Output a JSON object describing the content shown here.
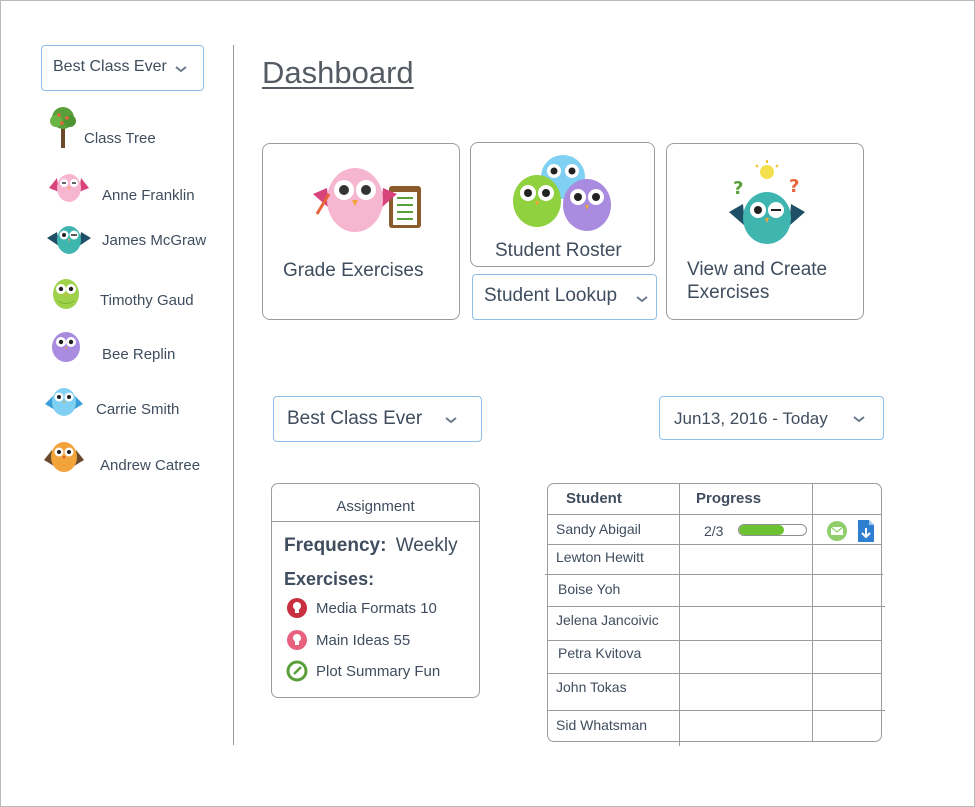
{
  "sidebar": {
    "class_select": "Best Class Ever",
    "items": [
      {
        "label": "Class Tree",
        "icon": "tree-icon"
      },
      {
        "label": "Anne Franklin",
        "icon": "owl-pink-icon",
        "color": "#f7b6cf"
      },
      {
        "label": "James McGraw",
        "icon": "owl-teal-icon",
        "color": "#3fb5b0"
      },
      {
        "label": "Timothy Gaud",
        "icon": "owl-green-icon",
        "color": "#9fd24a"
      },
      {
        "label": "Bee Replin",
        "icon": "owl-purple-icon",
        "color": "#a98be0"
      },
      {
        "label": "Carrie Smith",
        "icon": "owl-blue-icon",
        "color": "#7fd0f2"
      },
      {
        "label": "Andrew Catree",
        "icon": "owl-orange-icon",
        "color": "#f2a33a"
      }
    ]
  },
  "main": {
    "title": "Dashboard",
    "cards": {
      "grade": "Grade Exercises",
      "roster": "Student Roster",
      "lookup": "Student Lookup",
      "view_line1": "View and Create",
      "view_line2": "Exercises"
    },
    "class_select": "Best Class Ever",
    "date_select": "Jun13, 2016 - Today"
  },
  "assignment": {
    "header": "Assignment",
    "frequency_label": "Frequency:",
    "frequency_value": "Weekly",
    "exercises_label": "Exercises:",
    "exercises": [
      {
        "name": "Media Formats 10",
        "icon": "lightbulb-icon"
      },
      {
        "name": "Main Ideas 55",
        "icon": "lightbulb-pink-icon"
      },
      {
        "name": "Plot Summary Fun",
        "icon": "edit-icon"
      }
    ]
  },
  "students_table": {
    "headers": [
      "Student",
      "Progress"
    ],
    "rows": [
      {
        "name": "Sandy Abigail",
        "progress": "2/3",
        "fraction": 0.67
      },
      {
        "name": "Lewton Hewitt"
      },
      {
        "name": "Boise Yoh"
      },
      {
        "name": "Jelena Jancoivic"
      },
      {
        "name": "Petra Kvitova"
      },
      {
        "name": "John Tokas"
      },
      {
        "name": "Sid Whatsman"
      }
    ]
  },
  "colors": {
    "accent_border": "#8fbfe8",
    "progress_green": "#6cc231",
    "text": "#3f4d5e"
  }
}
